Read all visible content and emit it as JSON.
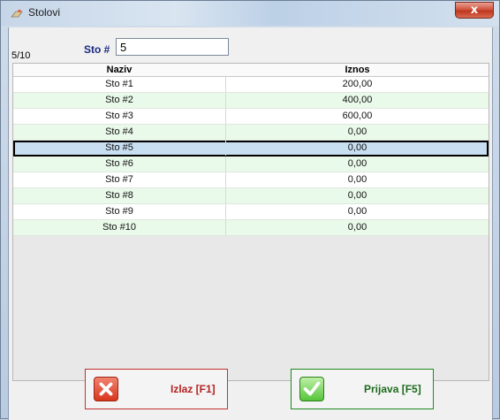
{
  "window": {
    "title": "Stolovi",
    "close_glyph": "x"
  },
  "filter": {
    "counter": "5/10",
    "label": "Sto #",
    "value": "5"
  },
  "table": {
    "columns": [
      "Naziv",
      "Iznos"
    ],
    "rows": [
      [
        "Sto #1",
        "200,00"
      ],
      [
        "Sto #2",
        "400,00"
      ],
      [
        "Sto #3",
        "600,00"
      ],
      [
        "Sto #4",
        "0,00"
      ],
      [
        "Sto #5",
        "0,00"
      ],
      [
        "Sto #6",
        "0,00"
      ],
      [
        "Sto #7",
        "0,00"
      ],
      [
        "Sto #8",
        "0,00"
      ],
      [
        "Sto #9",
        "0,00"
      ],
      [
        "Sto #10",
        "0,00"
      ]
    ],
    "selected_row": "Sto #5"
  },
  "buttons": {
    "exit": {
      "label": "Izlaz [F1]",
      "icon": "x-icon",
      "color": "#c53030"
    },
    "login": {
      "label": "Prijava [F5]",
      "icon": "checkmark-icon",
      "color": "#1f8a1f"
    }
  }
}
